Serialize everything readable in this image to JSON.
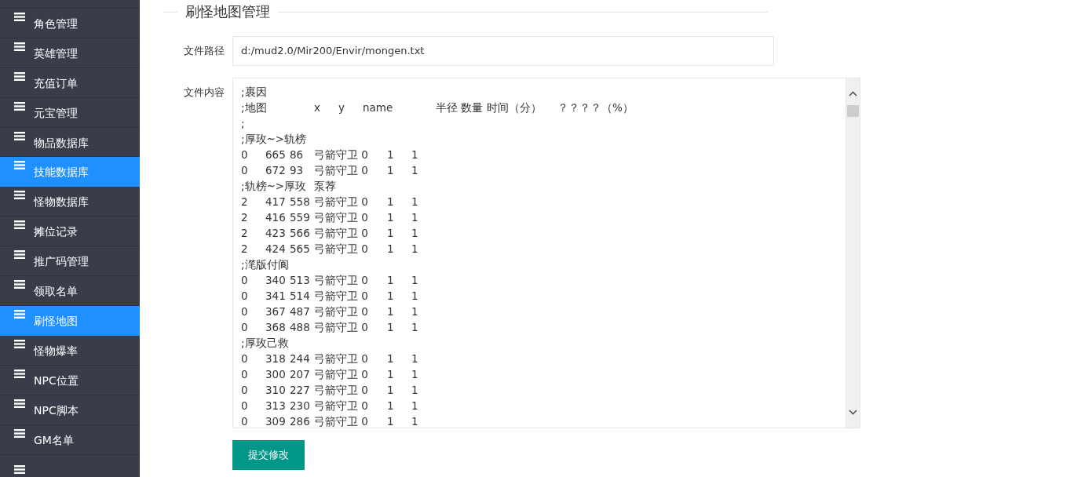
{
  "sidebar": {
    "items": [
      {
        "label": "角色管理",
        "selected": false
      },
      {
        "label": "英雄管理",
        "selected": false
      },
      {
        "label": "充值订单",
        "selected": false
      },
      {
        "label": "元宝管理",
        "selected": false
      },
      {
        "label": "物品数据库",
        "selected": false
      },
      {
        "label": "技能数据库",
        "selected": true
      },
      {
        "label": "怪物数据库",
        "selected": false
      },
      {
        "label": "摊位记录",
        "selected": false
      },
      {
        "label": "推广码管理",
        "selected": false
      },
      {
        "label": "领取名单",
        "selected": false
      },
      {
        "label": "刷怪地图",
        "selected": true
      },
      {
        "label": "怪物爆率",
        "selected": false
      },
      {
        "label": "NPC位置",
        "selected": false
      },
      {
        "label": "NPC脚本",
        "selected": false
      },
      {
        "label": "GM名单",
        "selected": false
      }
    ]
  },
  "title": "刷怪地图管理",
  "form": {
    "path_label": "文件路径",
    "path_value": "d:/mud2.0/Mir200/Envir/mongen.txt",
    "content_label": "文件内容",
    "content_lines": [
      ";裹因",
      ";地图\t\tx\ty\tname\t\t半径 数量 时间（分）\t？？？？（%）",
      ";",
      ";厚玫~>轨榜",
      "0\t665\t86\t弓箭守卫 0\t1\t1",
      "0\t672\t93\t弓箭守卫 0\t1\t1",
      ";轨榜~>厚玫\t泵荐",
      "2\t417\t558\t弓箭守卫 0\t1\t1",
      "2\t416\t559\t弓箭守卫 0\t1\t1",
      "2\t423\t566\t弓箭守卫 0\t1\t1",
      "2\t424\t565\t弓箭守卫 0\t1\t1",
      ";滗版付阆",
      "0\t340\t513\t弓箭守卫 0\t1\t1",
      "0\t341\t514\t弓箭守卫 0\t1\t1",
      "0\t367\t487\t弓箭守卫 0\t1\t1",
      "0\t368\t488\t弓箭守卫 0\t1\t1",
      ";厚玫己救",
      "0\t318\t244\t弓箭守卫 0\t1\t1",
      "0\t300\t207\t弓箭守卫 0\t1\t1",
      "0\t310\t227\t弓箭守卫 0\t1\t1",
      "0\t313\t230\t弓箭守卫 0\t1\t1",
      "0\t309\t286\t弓箭守卫 0\t1\t1"
    ],
    "submit": "提交修改"
  }
}
